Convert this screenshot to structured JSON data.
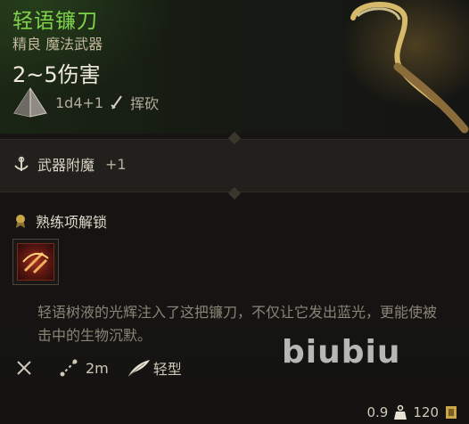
{
  "item": {
    "name": "轻语镰刀",
    "rarity_type": "精良 魔法武器",
    "damage": "2~5伤害",
    "dice": "1d4+1",
    "attack_type": "挥砍"
  },
  "enchant": {
    "label": "武器附魔",
    "value": "+1"
  },
  "proficiency": {
    "label": "熟练项解锁"
  },
  "description": "轻语树液的光辉注入了这把镰刀，不仅让它发出蓝光，更能使被击中的生物沉默。",
  "properties": {
    "range": "2m",
    "weight_class": "轻型"
  },
  "watermark": "biubiu",
  "footer": {
    "weight": "0.9",
    "price": "120"
  },
  "icons": {
    "dice": "d4-dice-icon",
    "attack": "slash-sword-icon",
    "enchant": "enchant-emblem-icon",
    "proficiency": "proficiency-medal-icon",
    "skill": "flourish-skill-icon",
    "weapon_type": "crossed-swords-icon",
    "range": "reach-icon",
    "light": "feather-icon",
    "weight": "weight-icon",
    "gold": "gold-icon"
  },
  "colors": {
    "rarity_green": "#7fd34a",
    "gold": "#c9a648"
  }
}
